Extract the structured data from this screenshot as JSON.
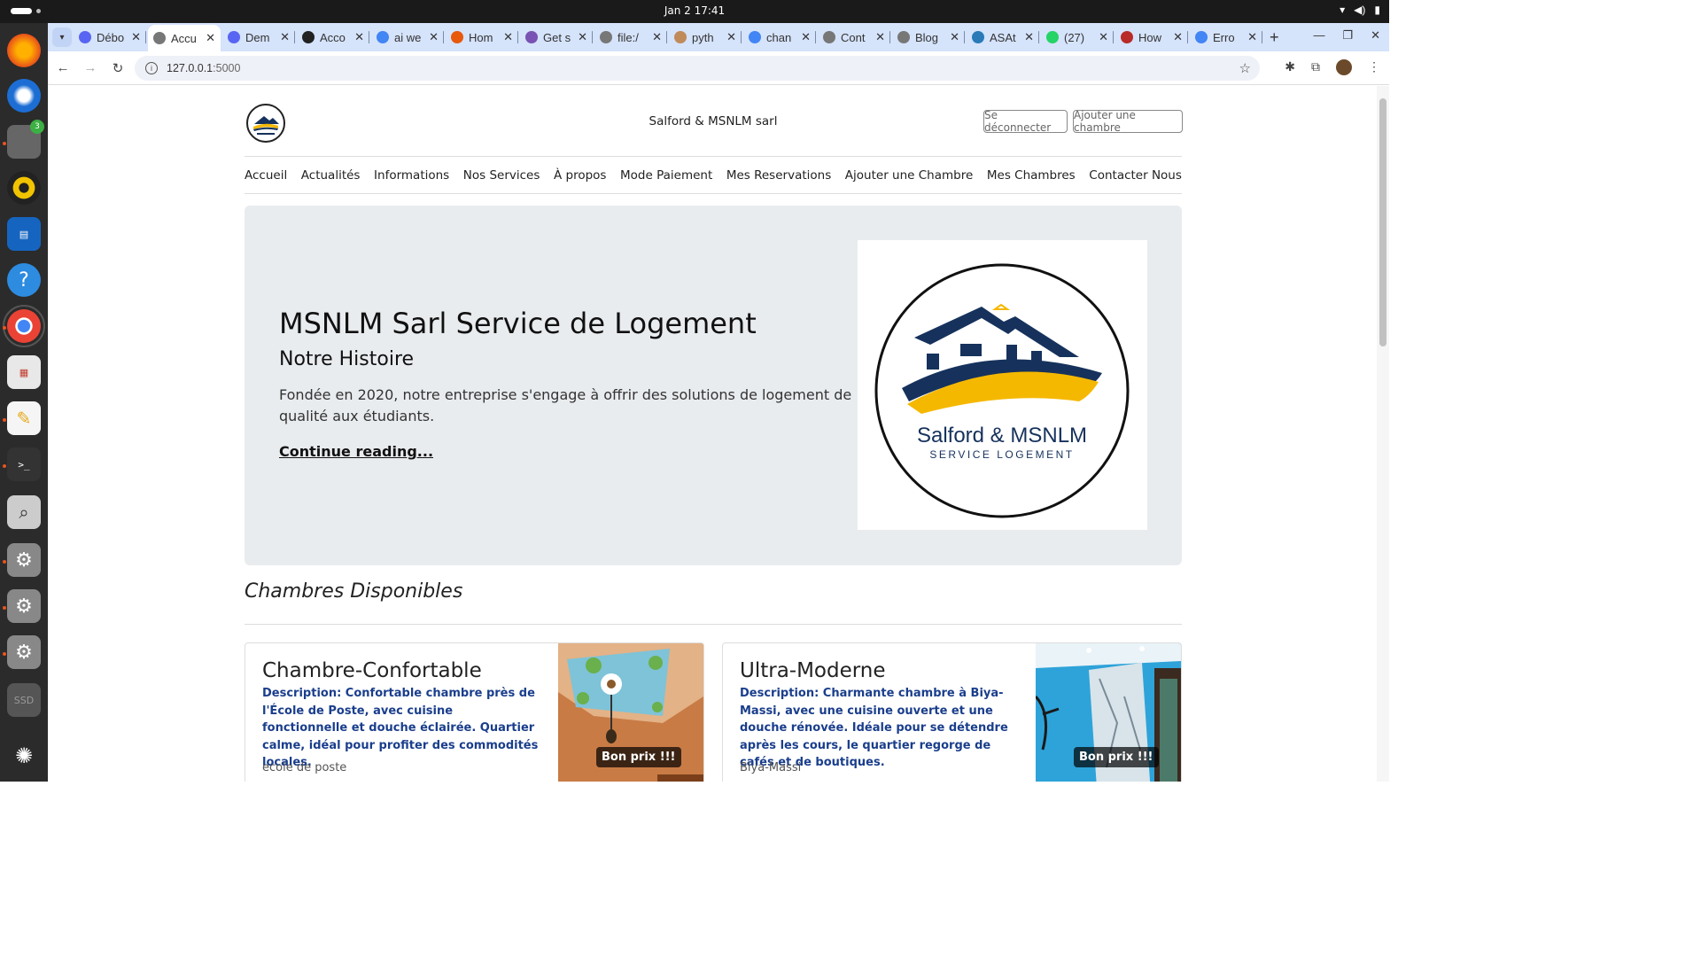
{
  "system": {
    "clock": "Jan 2  17:41",
    "dock_badge": "3",
    "ssd_label": "SSD"
  },
  "browser": {
    "tabs": [
      {
        "label": "Débo",
        "icon": "discord-icon",
        "color": "#5865f2"
      },
      {
        "label": "Accu",
        "icon": "globe-icon",
        "color": "#777",
        "active": true
      },
      {
        "label": "Dem",
        "icon": "discord-icon",
        "color": "#5865f2"
      },
      {
        "label": "Acco",
        "icon": "github-icon",
        "color": "#222"
      },
      {
        "label": "ai we",
        "icon": "google-icon",
        "color": "#4285f4"
      },
      {
        "label": "Hom",
        "icon": "arrow-icon",
        "color": "#e8590c"
      },
      {
        "label": "Get s",
        "icon": "bootstrap-icon",
        "color": "#7952b3"
      },
      {
        "label": "file:/",
        "icon": "globe-icon",
        "color": "#777"
      },
      {
        "label": "pyth",
        "icon": "flask-icon",
        "color": "#c08a5a"
      },
      {
        "label": "chan",
        "icon": "google-icon",
        "color": "#4285f4"
      },
      {
        "label": "Cont",
        "icon": "globe-icon",
        "color": "#777"
      },
      {
        "label": "Blog",
        "icon": "globe-icon",
        "color": "#777"
      },
      {
        "label": "ASAt",
        "icon": "copilot-icon",
        "color": "#2a7ab8"
      },
      {
        "label": "(27) ",
        "icon": "whatsapp-icon",
        "color": "#25d366"
      },
      {
        "label": "How",
        "icon": "quora-icon",
        "color": "#b92b27"
      },
      {
        "label": "Erro",
        "icon": "google-icon",
        "color": "#4285f4"
      }
    ],
    "url_host": "127.0.0.1",
    "url_port": ":5000"
  },
  "site": {
    "name": "Salford & MSNLM sarl",
    "logout_label": "Se déconnecter",
    "add_room_label": "Ajouter une chambre",
    "nav": [
      "Accueil",
      "Actualités",
      "Informations",
      "Nos Services",
      "À propos",
      "Mode Paiement",
      "Mes Reservations",
      "Ajouter une Chambre",
      "Mes Chambres",
      "Contacter Nous"
    ]
  },
  "hero": {
    "title": "MSNLM Sarl Service de Logement",
    "subtitle": "Notre Histoire",
    "text": "Fondée en 2020, notre entreprise s'engage à offrir des solutions de logement de qualité aux étudiants.",
    "link": "Continue reading...",
    "logo_line1": "Salford & MSNLM",
    "logo_line2": "SERVICE LOGEMENT"
  },
  "rooms": {
    "heading": "Chambres Disponibles",
    "items": [
      {
        "title": "Chambre-Confortable",
        "description": "Description: Confortable chambre près de l'École de Poste, avec cuisine fonctionnelle et douche éclairée. Quartier calme, idéal pour profiter des commodités locales.",
        "location": "ecole de poste",
        "tag": "Bon prix !!!"
      },
      {
        "title": "Ultra-Moderne",
        "description": "Description: Charmante chambre à Biya-Massi, avec une cuisine ouverte et une douche rénovée. Idéale pour se détendre après les cours, le quartier regorge de cafés et de boutiques.",
        "location": "Biya-Massi",
        "tag": "Bon prix !!!"
      }
    ]
  },
  "colors": {
    "brand_navy": "#16325c",
    "brand_yellow": "#f5b800",
    "description_blue": "#1a3e8c"
  }
}
